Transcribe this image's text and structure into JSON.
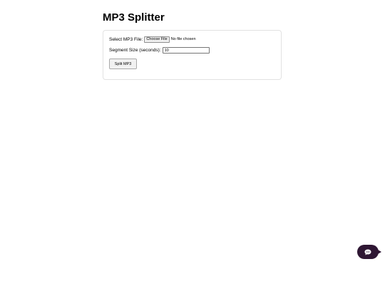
{
  "page": {
    "title": "MP3 Splitter"
  },
  "form": {
    "file_label": "Select MP3 File:",
    "file_button_label": "Choose File",
    "file_status": "No file chosen",
    "segment_label": "Segment Size (seconds):",
    "segment_value": "10",
    "split_button_label": "Split MP3"
  },
  "widgets": {
    "chat_icon": "chat-bubble-icon",
    "chat_color": "#2e1633"
  }
}
